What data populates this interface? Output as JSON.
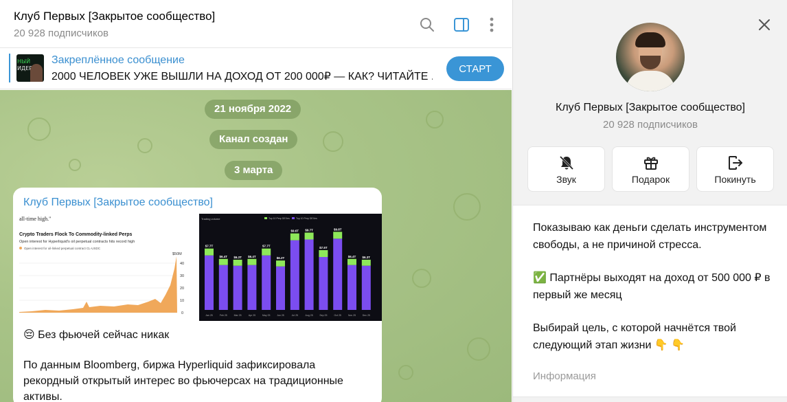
{
  "chat": {
    "title": "Клуб Первых [Закрытое сообщество]",
    "subtitle": "20 928 подписчиков",
    "icons": [
      "search-icon",
      "sidebar-toggle-icon",
      "more-vertical-icon"
    ]
  },
  "pinned": {
    "title": "Закреплённое сообщение",
    "text": "2000 ЧЕЛОВЕК УЖЕ ВЫШЛИ НА ДОХОД ОТ 200 000₽ — КАК? ЧИТАЙТЕ ...",
    "thumb_line1": "НЫЙ",
    "thumb_line2": "ИДЕР",
    "start_button": "СТАРТ"
  },
  "service_messages": {
    "date1": "21 ноября 2022",
    "created": "Канал создан",
    "date2": "3 марта"
  },
  "message": {
    "author": "Клуб Первых [Закрытое сообщество]",
    "image_left": {
      "top_text": "all-time high.\"",
      "heading": "Crypto Traders Flock To Commodity-linked Perps",
      "subheading": "Open interest for Hyperliquid's oil perpetual contracts hits record high",
      "legend": "Open interest for oil-linked perpetual contract CL-USDC",
      "y_max_label": "$50M",
      "y_ticks": [
        "40",
        "30",
        "20",
        "10",
        "0"
      ]
    },
    "image_right": {
      "header_left": "Trading volume",
      "legend_a": "Top 10 Perp DEXes",
      "legend_b": "Top 10 Perp DEXes",
      "bar_labels": [
        "$7.7T",
        "$6.4T",
        "$6.3T",
        "$6.4T",
        "$7.7T",
        "$6.2T",
        "$9.6T",
        "$9.7T",
        "$7.5T",
        "$9.8T",
        "$6.4T",
        "$6.3T"
      ],
      "months": [
        "Jan 25",
        "Feb 25",
        "Mar 25",
        "Apr 25",
        "May 25",
        "Jun 25",
        "Jul 25",
        "Aug 25",
        "Sep 25",
        "Oct 25",
        "Nov 25",
        "Dec 25"
      ]
    },
    "emoji_line": "😔 Без фьючей сейчас никак",
    "body": "По данным Bloomberg, биржа Hyperliquid зафиксировала рекордный открытый интерес во фьючерсах на традиционные активы."
  },
  "panel": {
    "name": "Клуб Первых [Закрытое сообщество]",
    "subscribers": "20 928 подписчиков",
    "actions": [
      {
        "label": "Звук",
        "icon": "bell-off-icon"
      },
      {
        "label": "Подарок",
        "icon": "gift-icon"
      },
      {
        "label": "Покинуть",
        "icon": "leave-icon"
      }
    ],
    "description": {
      "line1": "Показываю как деньги сделать инструментом свободы, а не причиной стресса.",
      "line2": "✅ Партнёры выходят на доход от 500 000 ₽ в первый же месяц",
      "line3": "Выбирай цель, с которой начнётся твой следующий этап жизни 👇 👇"
    },
    "info_label": "Информация"
  },
  "colors": {
    "accent": "#3a95d6",
    "chart_bar": "#7b4df0",
    "chart_top": "#8ee85a",
    "area_fill": "#f0a85a"
  }
}
